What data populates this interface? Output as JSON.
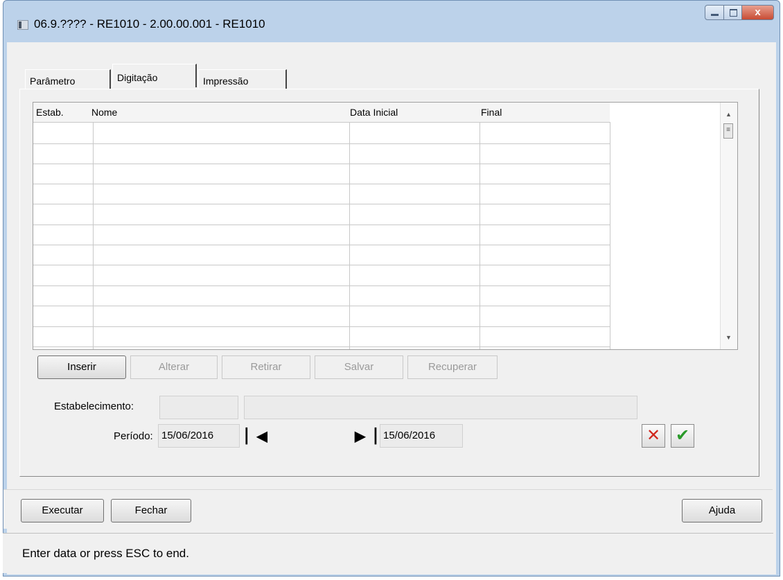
{
  "window": {
    "title": "06.9.???? - RE1010 - 2.00.00.001 - RE1010",
    "close_label": "x"
  },
  "tabs": [
    {
      "label": "Parâmetro",
      "active": false
    },
    {
      "label": "Digitação",
      "active": true
    },
    {
      "label": "Impressão",
      "active": false
    }
  ],
  "grid": {
    "columns": [
      "Estab.",
      "Nome",
      "Data Inicial",
      "Final"
    ],
    "rows": []
  },
  "actions": {
    "inserir": "Inserir",
    "alterar": "Alterar",
    "retirar": "Retirar",
    "salvar": "Salvar",
    "recuperar": "Recuperar"
  },
  "form": {
    "estabelecimento_label": "Estabelecimento:",
    "estabelecimento_code": "",
    "estabelecimento_name": "",
    "periodo_label": "Período:",
    "periodo_start": "15/06/2016",
    "periodo_end": "15/06/2016"
  },
  "footer": {
    "executar_label": "Executar",
    "fechar_label": "Fechar",
    "ajuda_label": "Ajuda"
  },
  "status_text": "Enter data or press ESC to end.",
  "colors": {
    "title_bar": "#bcd2ea",
    "cancel_red": "#d0281e",
    "confirm_green": "#2a9a2a"
  }
}
